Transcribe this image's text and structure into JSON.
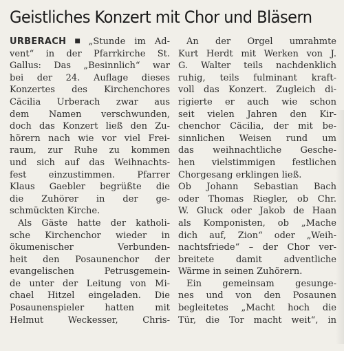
{
  "article": {
    "headline": "Geistliches Konzert mit Chor und Bläsern",
    "dateline": "URBERACH",
    "dateline_marker": "■",
    "column1": [
      {
        "text": "„Stunde im Ad-",
        "lead": true
      },
      {
        "text": "vent“ in der Pfarrkirche St."
      },
      {
        "text": "Gallus: Das „Besinnlich“ war"
      },
      {
        "text": "bei der 24. Auflage dieses"
      },
      {
        "text": "Konzertes des Kirchenchores"
      },
      {
        "text": "Cäcilia Urberach zwar aus"
      },
      {
        "text": "dem Namen verschwunden,"
      },
      {
        "text": "doch das Konzert ließ den Zu-"
      },
      {
        "text": "hörern nach wie vor viel Frei-"
      },
      {
        "text": "raum, zur Ruhe zu kommen"
      },
      {
        "text": "und sich auf das Weihnachts-"
      },
      {
        "text": "fest einzustimmen. Pfarrer"
      },
      {
        "text": "Klaus Gaebler begrüßte die"
      },
      {
        "text": "die Zuhörer in der ge-"
      },
      {
        "text": "schmückten Kirche.",
        "last": true
      },
      {
        "text": "Als Gäste hatte der katholi-",
        "indent": true
      },
      {
        "text": "sche Kirchenchor wieder in"
      },
      {
        "text": "ökumenischer Verbunden-"
      },
      {
        "text": "heit den Posaunenchor der"
      },
      {
        "text": "evangelischen Petrusgemein-"
      },
      {
        "text": "de unter der Leitung von Mi-"
      },
      {
        "text": "chael Hitzel eingeladen. Die"
      },
      {
        "text": "Posaunenspieler hatten mit"
      },
      {
        "text": "Helmut Weckesser, Chris-"
      }
    ],
    "column2": [
      {
        "text": "An der Orgel umrahmte",
        "indent": true
      },
      {
        "text": "Kurt Herdt mit Werken von J."
      },
      {
        "text": "G. Walter teils nachdenklich"
      },
      {
        "text": "ruhig, teils fulminant kraft-"
      },
      {
        "text": "voll das Konzert. Zugleich di-"
      },
      {
        "text": "rigierte er auch wie schon"
      },
      {
        "text": "seit vielen Jahren den Kir-"
      },
      {
        "text": "chenchor Cäcilia, der mit be-"
      },
      {
        "text": "sinnlichen Weisen rund um"
      },
      {
        "text": "das weihnachtliche Gesche-"
      },
      {
        "text": "hen vielstimmigen festlichen"
      },
      {
        "text": "Chorgesang erklingen ließ.",
        "last": true
      },
      {
        "text": "Ob Johann Sebastian Bach"
      },
      {
        "text": "oder Thomas Riegler, ob Chr."
      },
      {
        "text": "W. Gluck oder Jakob de Haan"
      },
      {
        "text": "als Komponisten, ob „Mache"
      },
      {
        "text": "dich auf, Zion“ oder „Weih-"
      },
      {
        "text": "nachtsfriede“ – der Chor ver-"
      },
      {
        "text": "breitete damit adventliche"
      },
      {
        "text": "Wärme in seinen Zuhörern.",
        "last": true
      },
      {
        "text": "Ein gemeinsam gesunge-",
        "indent": true
      },
      {
        "text": "nes und von den Posaunen"
      },
      {
        "text": "begleitetes „Macht hoch die"
      },
      {
        "text": "Tür, die Tor macht weit“, in"
      }
    ]
  }
}
